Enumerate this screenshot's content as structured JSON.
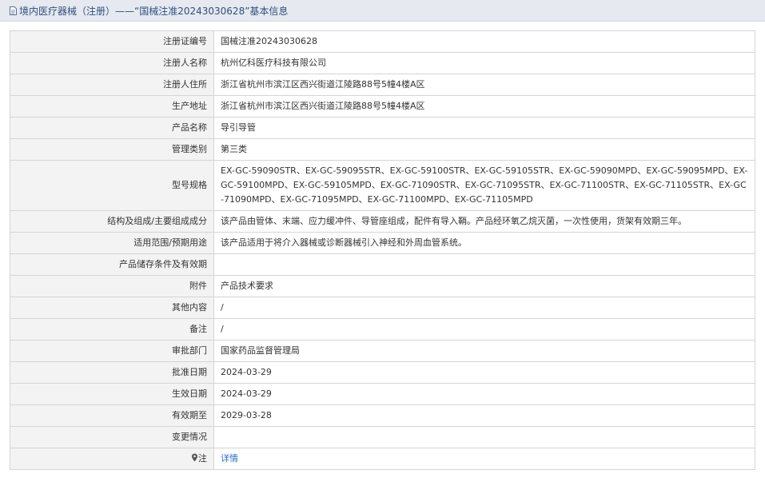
{
  "header": {
    "icon": "document-icon",
    "title": "境内医疗器械（注册）——“国械注准20243030628”基本信息"
  },
  "rows": [
    {
      "label": "注册证编号",
      "value": "国械注准20243030628"
    },
    {
      "label": "注册人名称",
      "value": "杭州亿科医疗科技有限公司"
    },
    {
      "label": "注册人住所",
      "value": "浙江省杭州市滨江区西兴街道江陵路88号5幢4楼A区"
    },
    {
      "label": "生产地址",
      "value": "浙江省杭州市滨江区西兴街道江陵路88号5幢4楼A区"
    },
    {
      "label": "产品名称",
      "value": "导引导管"
    },
    {
      "label": "管理类别",
      "value": "第三类"
    },
    {
      "label": "型号规格",
      "value": "EX-GC-59090STR、EX-GC-59095STR、EX-GC-59100STR、EX-GC-59105STR、EX-GC-59090MPD、EX-GC-59095MPD、EX-GC-59100MPD、EX-GC-59105MPD、EX-GC-71090STR、EX-GC-71095STR、EX-GC-71100STR、EX-GC-71105STR、EX-GC-71090MPD、EX-GC-71095MPD、EX-GC-71100MPD、EX-GC-71105MPD"
    },
    {
      "label": "结构及组成/主要组成成分",
      "value": "该产品由管体、末端、应力缓冲件、导管座组成，配件有导入鞘。产品经环氧乙烷灭菌，一次性使用，货架有效期三年。"
    },
    {
      "label": "适用范围/预期用途",
      "value": "该产品适用于将介入器械或诊断器械引入神经和外周血管系统。"
    },
    {
      "label": "产品储存条件及有效期",
      "value": ""
    },
    {
      "label": "附件",
      "value": "产品技术要求"
    },
    {
      "label": "其他内容",
      "value": "/"
    },
    {
      "label": "备注",
      "value": "/"
    },
    {
      "label": "审批部门",
      "value": "国家药品监督管理局"
    },
    {
      "label": "批准日期",
      "value": "2024-03-29"
    },
    {
      "label": "生效日期",
      "value": "2024-03-29"
    },
    {
      "label": "有效期至",
      "value": "2029-03-28"
    },
    {
      "label": "变更情况",
      "value": ""
    }
  ],
  "note": {
    "icon": "pin-icon",
    "label": "注",
    "link_text": "详情",
    "link_color": "#2a6bbf"
  }
}
